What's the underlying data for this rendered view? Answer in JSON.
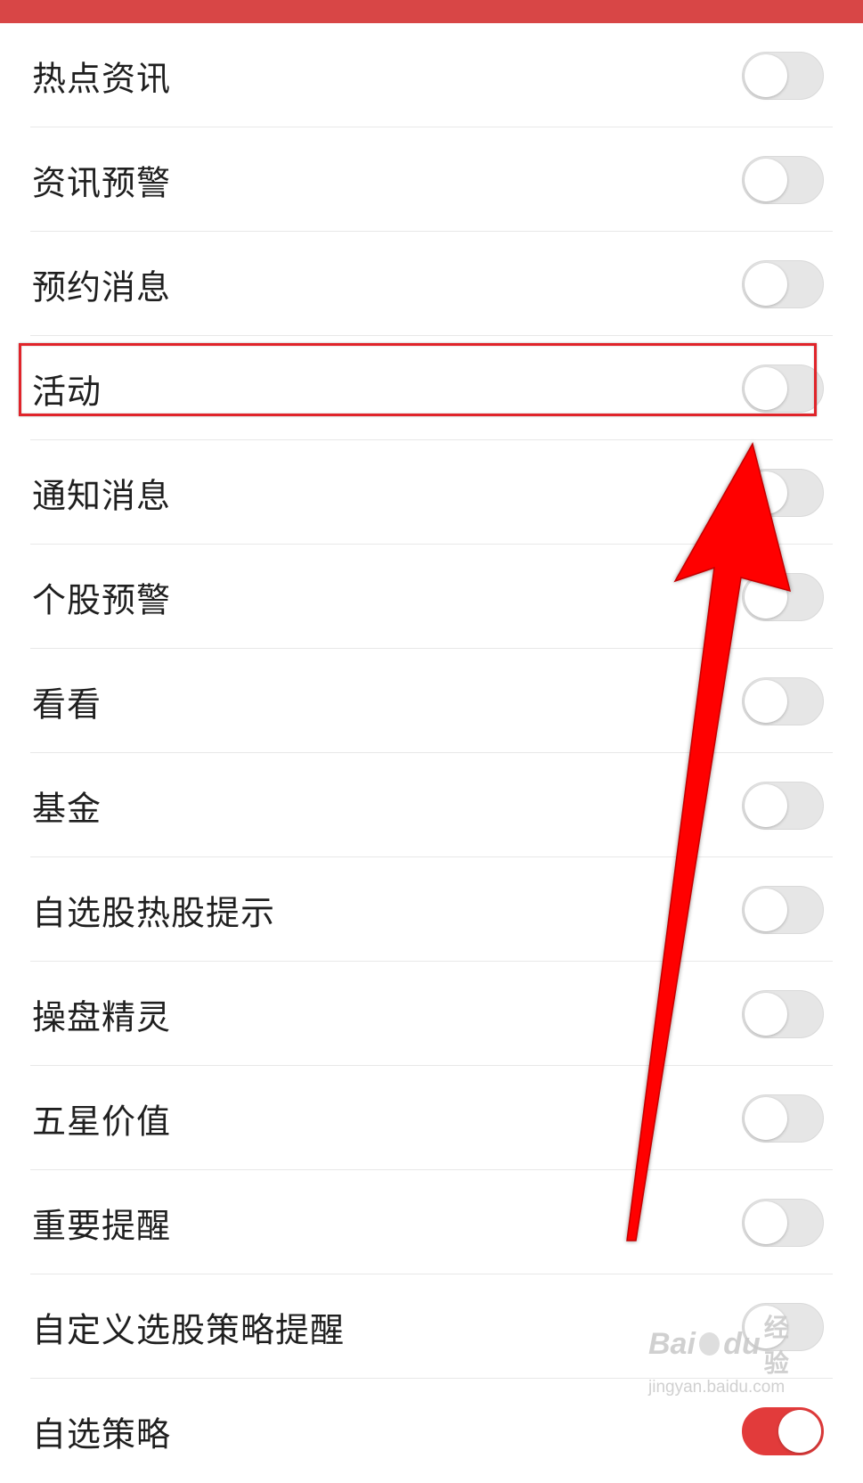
{
  "settings": {
    "items": [
      {
        "label": "热点资讯",
        "enabled": false
      },
      {
        "label": "资讯预警",
        "enabled": false
      },
      {
        "label": "预约消息",
        "enabled": false
      },
      {
        "label": "活动",
        "enabled": false
      },
      {
        "label": "通知消息",
        "enabled": false
      },
      {
        "label": "个股预警",
        "enabled": false
      },
      {
        "label": "看看",
        "enabled": false
      },
      {
        "label": "基金",
        "enabled": false
      },
      {
        "label": "自选股热股提示",
        "enabled": false
      },
      {
        "label": "操盘精灵",
        "enabled": false
      },
      {
        "label": "五星价值",
        "enabled": false
      },
      {
        "label": "重要提醒",
        "enabled": false
      },
      {
        "label": "自定义选股策略提醒",
        "enabled": false
      },
      {
        "label": "自选策略",
        "enabled": true
      }
    ]
  },
  "annotation": {
    "highlighted_item": "活动",
    "highlight_color": "#e0242a",
    "arrow_color": "#ff0000"
  },
  "watermark": {
    "logo_text": "Bai",
    "logo_text_2": "du",
    "logo_cn": "经验",
    "url": "jingyan.baidu.com"
  },
  "colors": {
    "top_bar": "#d84646",
    "toggle_off": "#e6e6e6",
    "toggle_on": "#e23b3b"
  }
}
